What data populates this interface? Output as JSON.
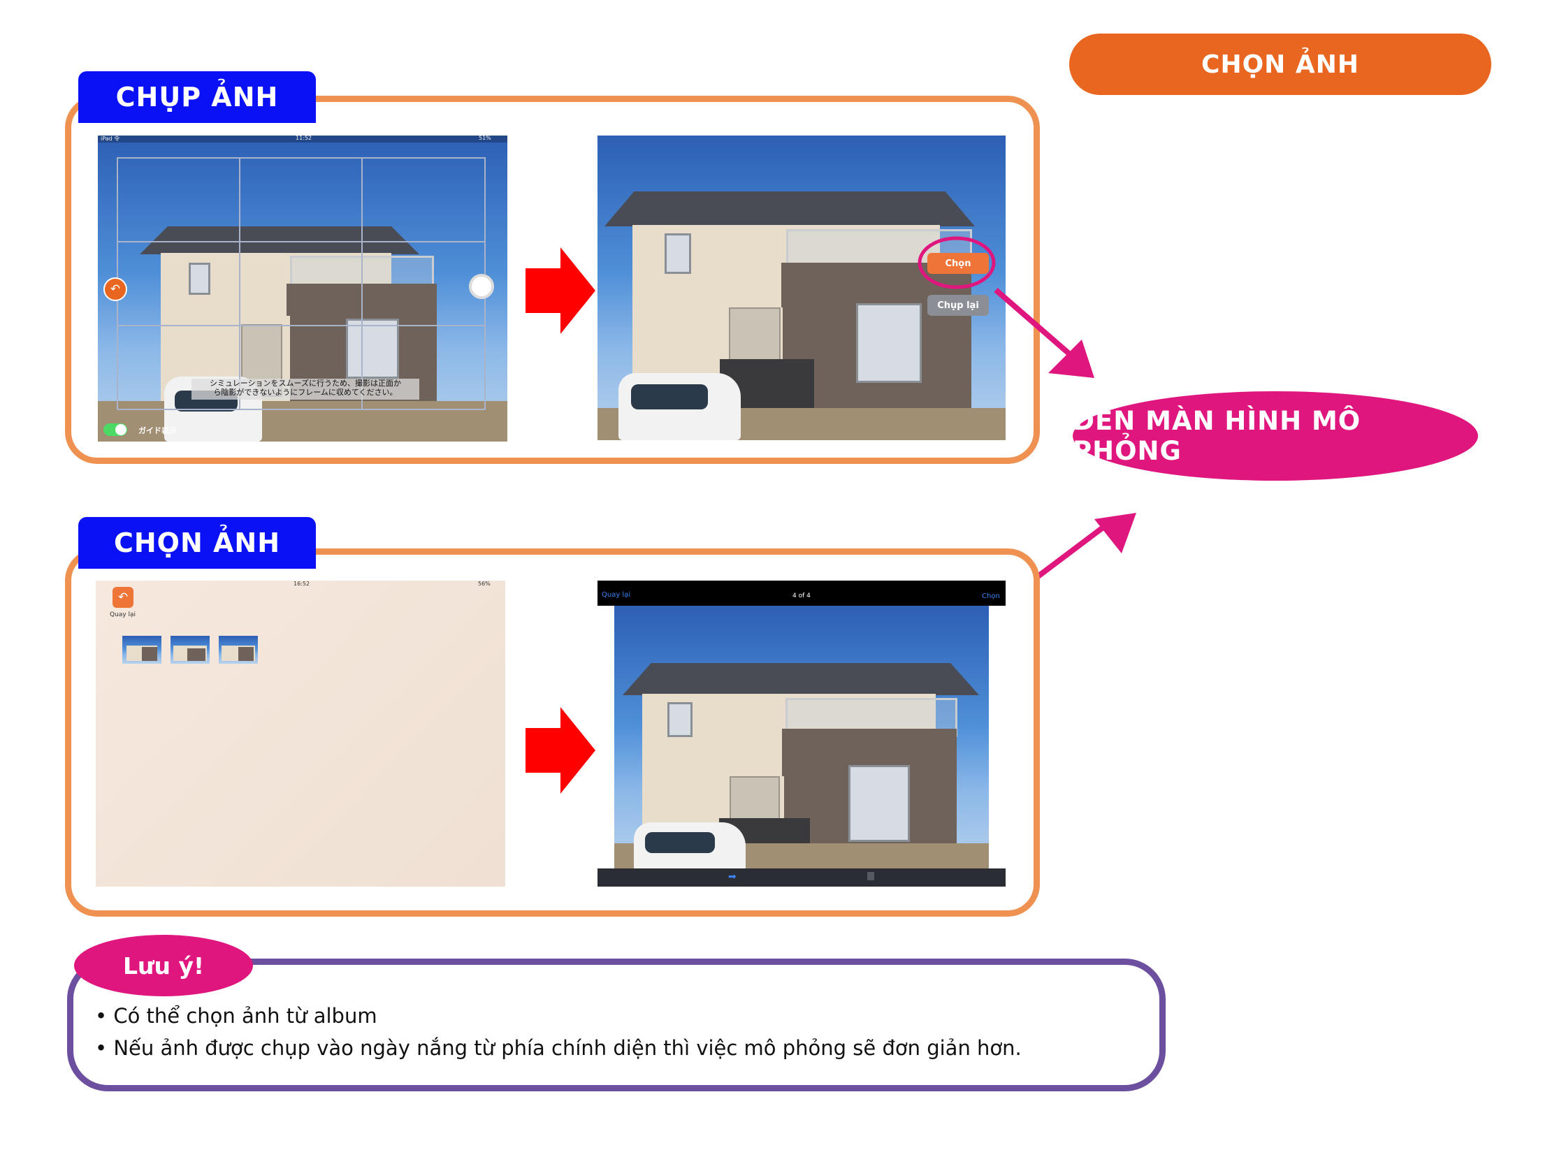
{
  "top_pill": {
    "label": "CHỌN ẢNH"
  },
  "section_capture": {
    "tab_label": "CHỤP ẢNH",
    "camera_screen": {
      "status_left": "iPad 令",
      "status_center": "11:52",
      "status_right": "51%",
      "overlay_text_line1": "シミュレーションをスムーズに行うため、撮影は正面か",
      "overlay_text_line2": "ら陰影ができないようにフレームに収めてください。",
      "guide_toggle_label": "ガイド表示"
    },
    "preview_screen": {
      "select_button": "Chọn",
      "retake_button": "Chụp lại"
    }
  },
  "section_album": {
    "tab_label": "CHỌN ẢNH",
    "album_screen": {
      "status_center": "16:52",
      "status_right": "56%",
      "back_label": "Quay lại",
      "thumbnail_count": 3
    },
    "viewer_screen": {
      "back_label": "Quay lại",
      "counter": "4 of 4",
      "select_label": "Chọn"
    }
  },
  "destination": {
    "label": "ĐẾN MÀN HÌNH MÔ PHỎNG"
  },
  "note": {
    "tab_label": "Lưu ý!",
    "items": [
      "Có thể chọn ảnh từ album",
      "Nếu ảnh được chụp vào ngày nắng từ phía chính diện thì việc mô phỏng sẽ đơn giản hơn."
    ]
  },
  "colors": {
    "orange": "#e8661f",
    "frame_orange": "#ef9150",
    "tab_blue": "#0a12f5",
    "pink": "#e0167f",
    "purple": "#6d4fa0",
    "arrow_red": "#ff0000"
  }
}
